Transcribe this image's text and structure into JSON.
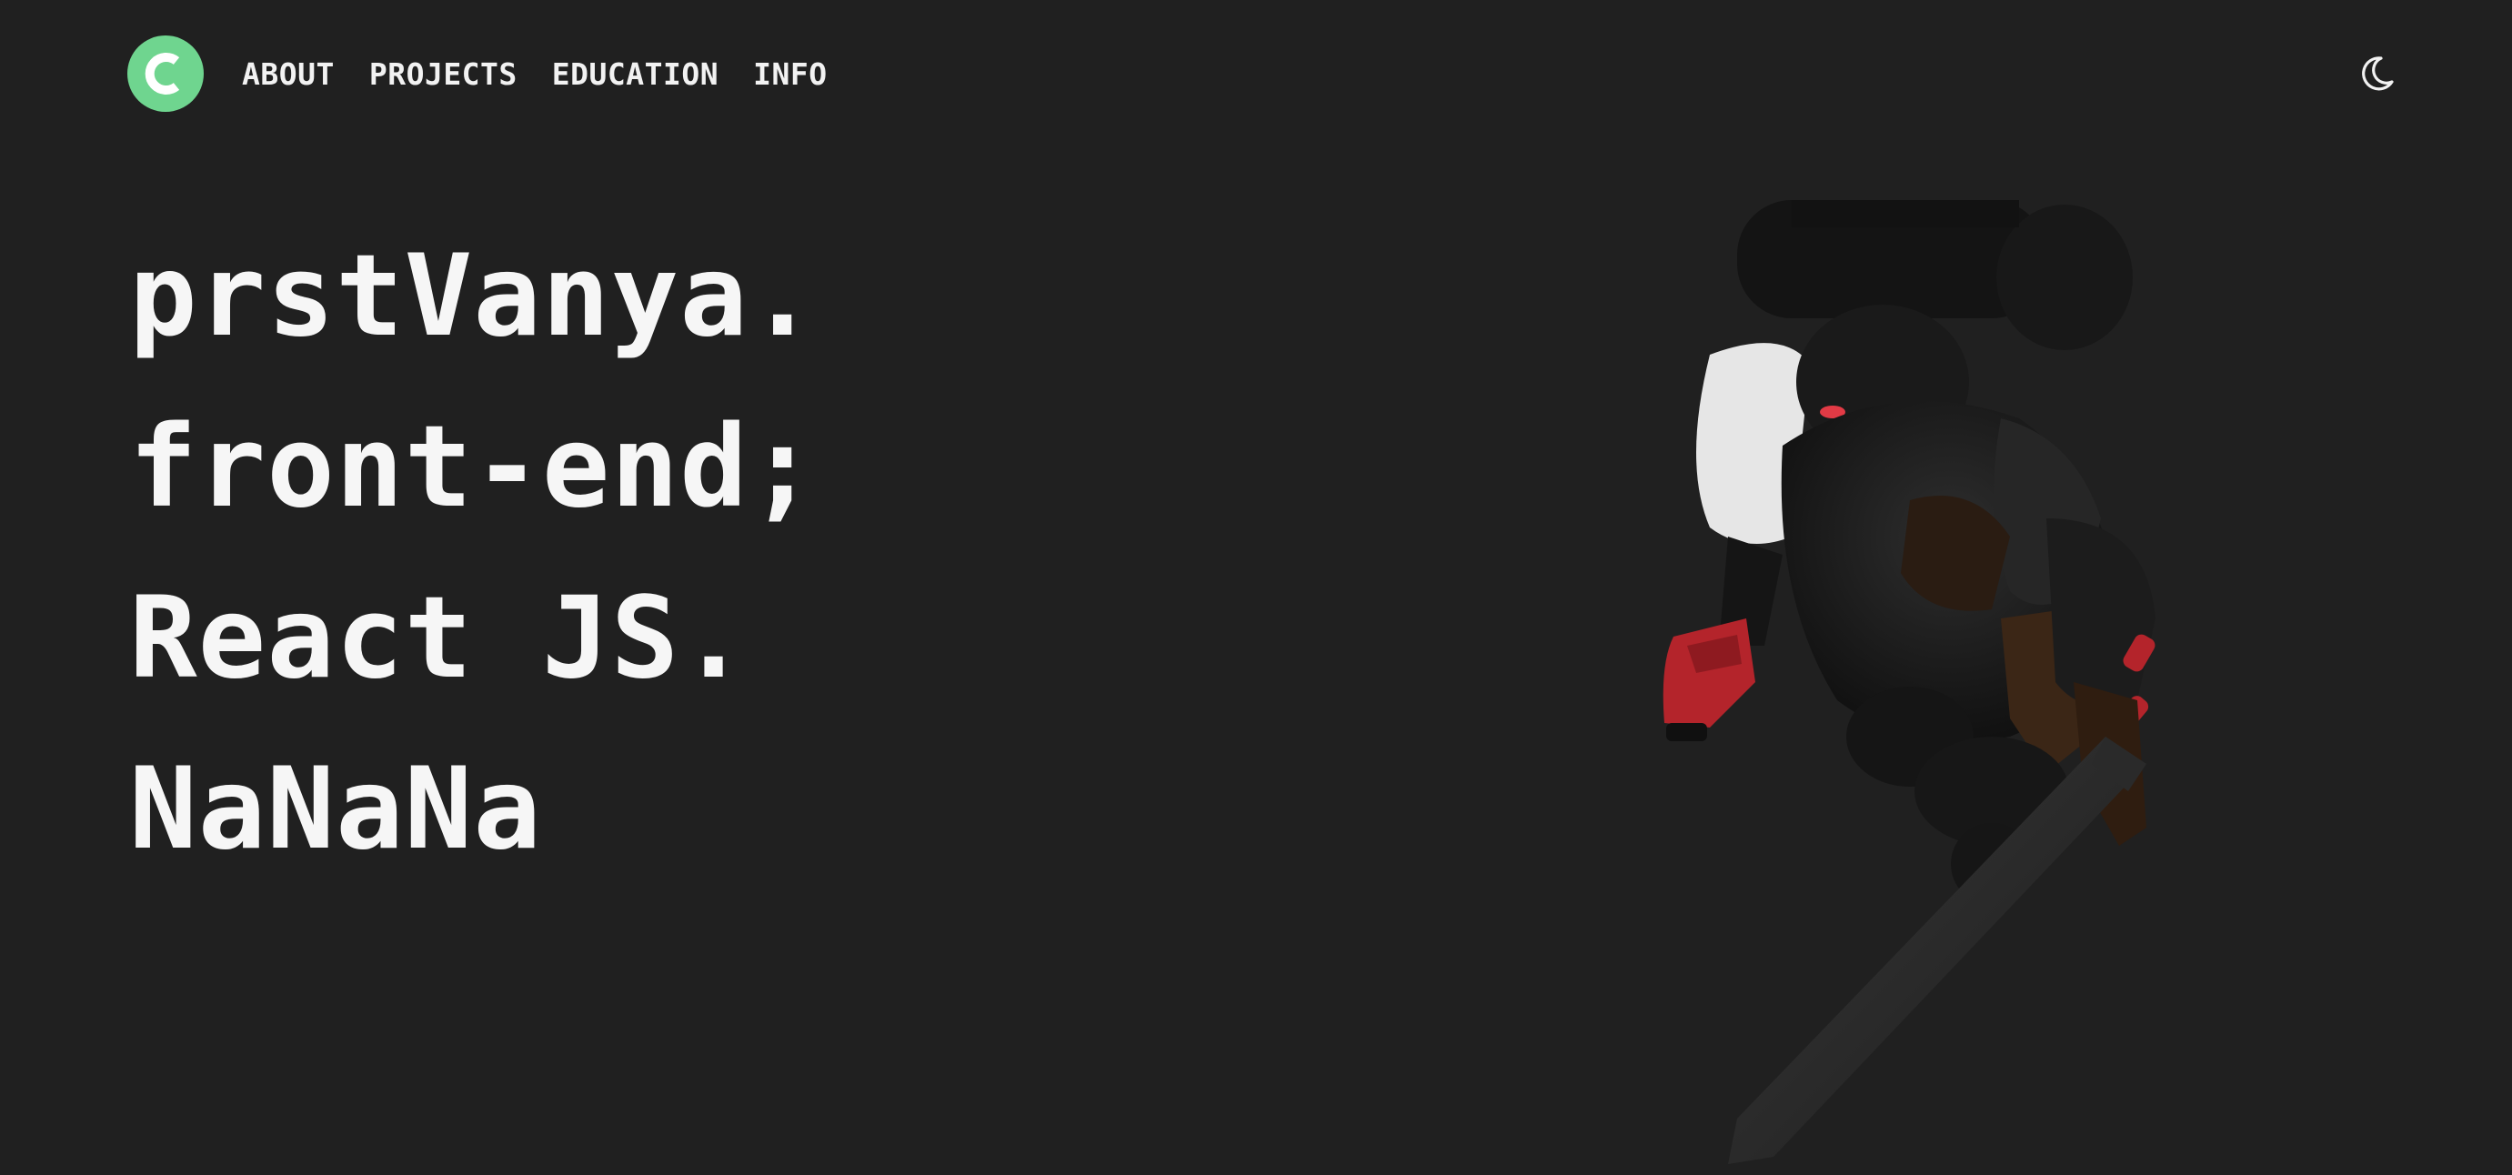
{
  "nav": {
    "logo_icon": "c-logo-icon",
    "logo_color": "#6fd58f",
    "links": [
      "ABOUT",
      "PROJECTS",
      "EDUCATION",
      "INFO"
    ],
    "theme_icon": "moon-icon"
  },
  "hero": {
    "lines": [
      "prstVanya.",
      "front-end;",
      "React JS.",
      "NaNaNa"
    ]
  },
  "scene": {
    "model_icon": "armored-knight-model"
  },
  "colors": {
    "background": "#202020",
    "text": "#f6f6f6",
    "accent": "#6fd58f",
    "model_red": "#b4242b"
  }
}
